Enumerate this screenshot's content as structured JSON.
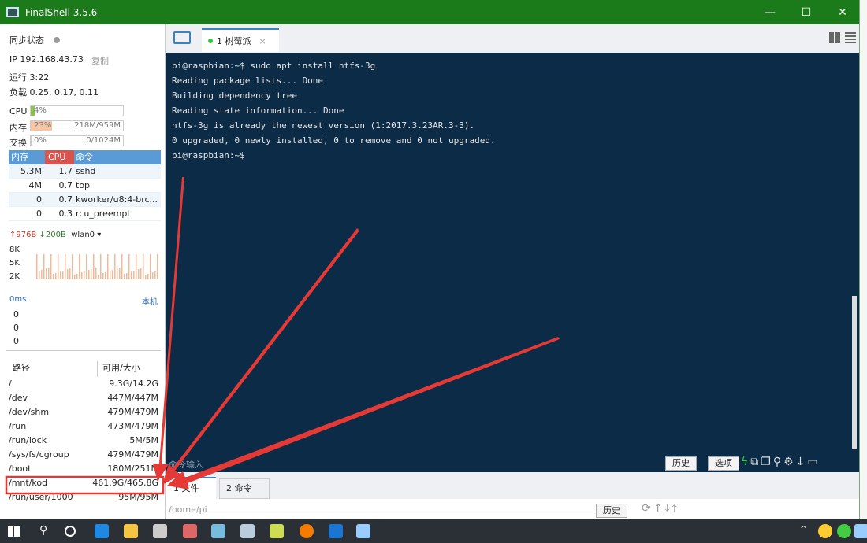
{
  "window": {
    "title": "FinalShell 3.5.6"
  },
  "status": {
    "sync_label": "同步状态",
    "ip": "IP 192.168.43.73",
    "copy": "复制",
    "uptime": "运行 3:22",
    "load": "负载 0.25, 0.17, 0.11"
  },
  "meters": [
    {
      "label": "CPU",
      "percent_text": "4%",
      "percent": 4,
      "detail": "",
      "color": "#8bc34a"
    },
    {
      "label": "内存",
      "percent_text": "23%",
      "percent": 23,
      "detail": "218M/959M",
      "color": "#f7c5a3"
    },
    {
      "label": "交换",
      "percent_text": "0%",
      "percent": 0,
      "detail": "0/1024M",
      "color": "#ccc"
    }
  ],
  "processes": {
    "headers": [
      "内存",
      "CPU",
      "命令"
    ],
    "rows": [
      [
        "5.3M",
        "1.7",
        "sshd"
      ],
      [
        "4M",
        "0.7",
        "top"
      ],
      [
        "0",
        "0.7",
        "kworker/u8:4-brc..."
      ],
      [
        "0",
        "0.3",
        "rcu_preempt"
      ]
    ]
  },
  "network": {
    "up": "976B",
    "down": "200B",
    "iface": "wlan0",
    "ticks": [
      "8K",
      "5K",
      "2K"
    ]
  },
  "ping": {
    "latency": "0ms",
    "host": "本机",
    "values": [
      "0",
      "0",
      "0"
    ]
  },
  "disks": {
    "headers": [
      "路径",
      "可用/大小"
    ],
    "rows": [
      [
        "/",
        "9.3G/14.2G"
      ],
      [
        "/dev",
        "447M/447M"
      ],
      [
        "/dev/shm",
        "479M/479M"
      ],
      [
        "/run",
        "473M/479M"
      ],
      [
        "/run/lock",
        "5M/5M"
      ],
      [
        "/sys/fs/cgroup",
        "479M/479M"
      ],
      [
        "/boot",
        "180M/251M"
      ],
      [
        "/mnt/kod",
        "461.9G/465.8G"
      ],
      [
        "/run/user/1000",
        "95M/95M"
      ]
    ],
    "highlighted": "/mnt/kod"
  },
  "tabs": [
    {
      "label": "1 树莓派",
      "active": true
    }
  ],
  "terminal": {
    "lines": [
      "pi@raspbian:~$ sudo apt install ntfs-3g",
      "Reading package lists... Done",
      "Building dependency tree",
      "Reading state information... Done",
      "ntfs-3g is already the newest version (1:2017.3.23AR.3-3).",
      "0 upgraded, 0 newly installed, 0 to remove and 0 not upgraded.",
      "pi@raspbian:~$ "
    ],
    "command_placeholder": "命令输入",
    "history": "历史",
    "options": "选项"
  },
  "bottom": {
    "tabs": [
      "1 文件",
      "2 命令"
    ],
    "path": "/home/pi",
    "history": "历史"
  },
  "colors": {
    "titlebar": "#1b7b1b",
    "terminal_bg": "#0b2b47",
    "accent": "#5b9bd5",
    "annotation": "#e53935"
  }
}
